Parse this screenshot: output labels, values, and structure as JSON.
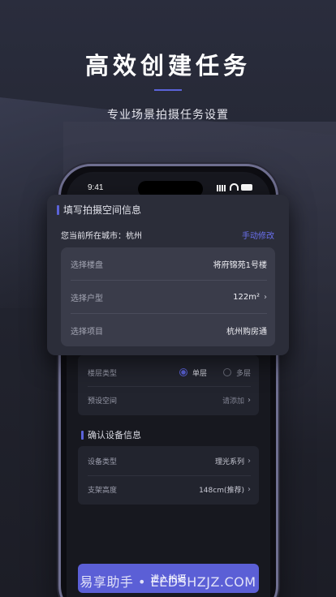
{
  "hero": {
    "title": "高效创建任务",
    "subtitle": "专业场景拍摄任务设置"
  },
  "status_bar": {
    "time": "9:41"
  },
  "float_card": {
    "section_title": "填写拍摄空间信息",
    "city_text": "您当前所在城市：杭州",
    "manual_link": "手动修改",
    "rows": [
      {
        "label": "选择楼盘",
        "value": "将府锦苑1号楼",
        "chevron": false
      },
      {
        "label": "选择户型",
        "value": "122m²",
        "chevron": true
      },
      {
        "label": "选择项目",
        "value": "杭州购房通",
        "chevron": false
      }
    ]
  },
  "space_card": {
    "floor_type_label": "楼层类型",
    "options": [
      {
        "label": "单层",
        "selected": true
      },
      {
        "label": "多层",
        "selected": false
      }
    ],
    "preset_label": "预设空间",
    "preset_value": "请添加"
  },
  "device_section": {
    "title": "确认设备信息",
    "rows": [
      {
        "label": "设备类型",
        "value": "理光系列"
      },
      {
        "label": "支架高度",
        "value": "148cm(推荐)"
      }
    ]
  },
  "enter_button": "进入拍摄",
  "watermark": "易享助手 • EEDSHZJZ.COM",
  "colors": {
    "accent": "#5b63d9",
    "link": "#6a70ee",
    "background": "#22242f",
    "card": "#2b2d39"
  }
}
